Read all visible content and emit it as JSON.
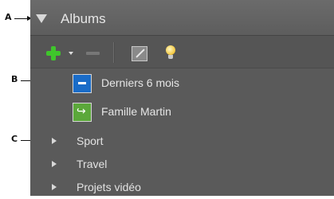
{
  "callouts": {
    "a": "A",
    "b": "B",
    "c": "C"
  },
  "panel": {
    "title": "Albums",
    "collapse_icon": "triangle-down-icon"
  },
  "toolbar": {
    "icons": [
      "plus-icon",
      "dropdown-arrow-icon",
      "minus-icon",
      "edit-icon",
      "lightbulb-icon"
    ]
  },
  "albums": [
    {
      "label": "Derniers 6 mois",
      "icon": "smart-album-icon"
    },
    {
      "label": "Famille Martin",
      "icon": "shared-album-icon"
    }
  ],
  "groups": [
    {
      "label": "Sport",
      "icon": "expand-triangle-icon"
    },
    {
      "label": "Travel",
      "icon": "expand-triangle-icon"
    },
    {
      "label": "Projets vidéo",
      "icon": "expand-triangle-icon"
    }
  ],
  "colors": {
    "panel_bg": "#5a5a5a",
    "header_bg": "#666666",
    "text": "#e6e6e6",
    "add_green": "#3fc52c",
    "album_blue": "#1a6cc8",
    "album_green": "#5ba83a"
  }
}
